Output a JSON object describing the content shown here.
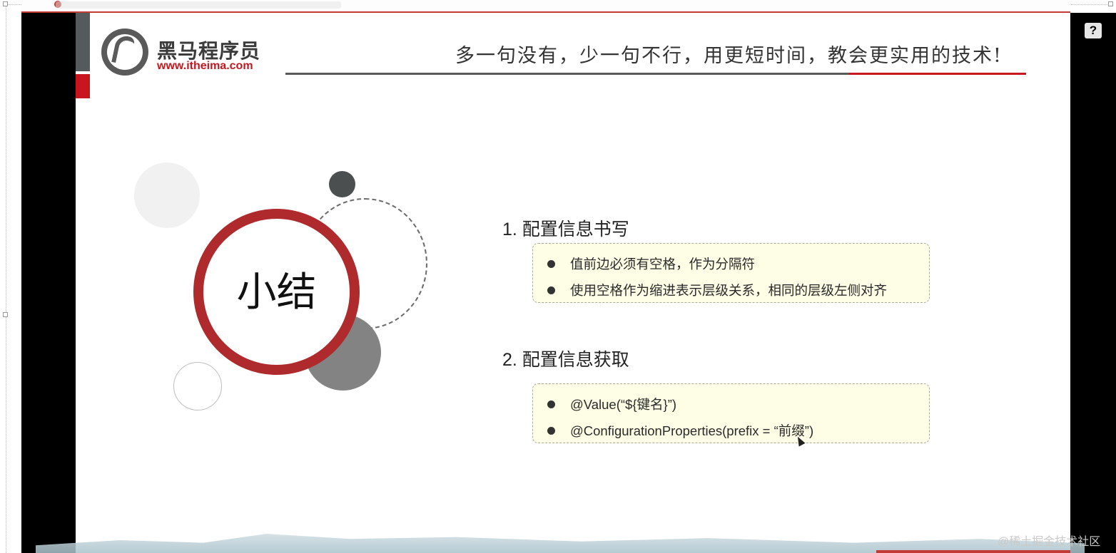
{
  "slide": {
    "brand_name": "黑马程序员",
    "brand_url": "www.itheima.com",
    "slogan": "多一句没有，少一句不行，用更短时间，教会更实用的技术!",
    "summary_title": "小结",
    "sections": [
      {
        "heading": "1.  配置信息书写",
        "items": [
          "值前边必须有空格，作为分隔符",
          "使用空格作为缩进表示层级关系，相同的层级左侧对齐"
        ]
      },
      {
        "heading": "2.  配置信息获取",
        "items": [
          "@Value(“${键名}”)",
          "@ConfigurationProperties(prefix = “前缀”)"
        ]
      }
    ]
  },
  "overlay": {
    "help_label": "?",
    "watermark": "@稀土掘金技术社区"
  },
  "colors": {
    "brand_red": "#c7161d",
    "ring_red": "#ae2a2c",
    "dark_gray": "#555a5c",
    "box_background": "#fefee6"
  },
  "icons": [
    "help-icon",
    "mouse-cursor-icon",
    "bullet-icon",
    "logo-horse-icon"
  ]
}
